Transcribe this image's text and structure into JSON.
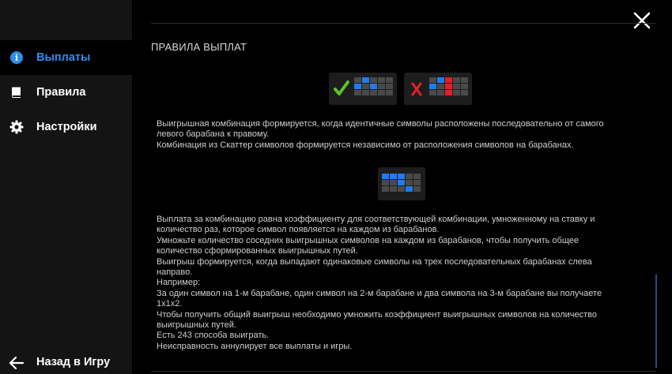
{
  "sidebar": {
    "items": [
      {
        "label": "Выплаты",
        "icon": "info-icon",
        "active": true
      },
      {
        "label": "Правила",
        "icon": "book-icon",
        "active": false
      },
      {
        "label": "Настройки",
        "icon": "gear-icon",
        "active": false
      }
    ],
    "back_label": "Назад в Игру"
  },
  "main": {
    "section_title": "ПРАВИЛА ВЫПЛАТ",
    "paragraph1": [
      "Выигрышная комбинация формируется, когда идентичные символы расположены последовательно от самого",
      "левого барабана к правому.",
      "Комбинация из Скаттер символов формируется независимо от расположения символов на барабанах."
    ],
    "paragraph2": [
      "Выплата за комбинацию равна коэффициенту для соответствующей комбинации, умноженному на ставку и",
      "количество раз, которое символ появляется на каждом из барабанов.",
      "Умножьте количество соседних выигрышных символов на каждом из барабанов, чтобы получить общее",
      "количество сформированных выигрышных путей.",
      "Выигрыш формируется, когда выпадают одинаковые символы на трех последовательных барабанах слева",
      "направо.",
      "Например:",
      "За один символ на 1-м барабане, один символ на 2-м барабане и два символа на 3-м барабане вы получаете",
      "1x1x2.",
      "Чтобы получить общий выигрыш необходимо умножить коэффициент выигрышных символов на количество",
      "выигрышных путей.",
      "Есть 243 способа выиграть.",
      "Неисправность аннулирует все выплаты и игры."
    ]
  },
  "colors": {
    "accent": "#2d8df2",
    "symbol_blue": "#1e7cf0",
    "symbol_red": "#e21f26",
    "check_green": "#5ec22c"
  },
  "icons": {
    "valid": "checkmark-icon",
    "invalid": "cross-icon",
    "close": "close-icon",
    "back": "arrow-left-icon"
  }
}
